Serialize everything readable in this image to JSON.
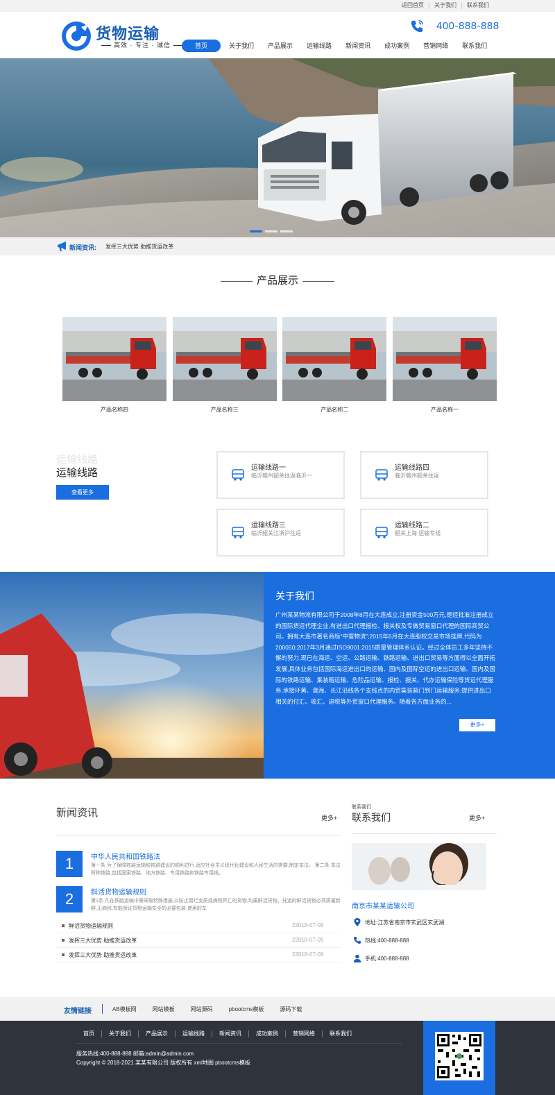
{
  "colors": {
    "accent": "#1a6ee0",
    "brand_dark": "#1a5fb4",
    "footer_bg": "#2f333c"
  },
  "topbar": {
    "links": [
      "返回首页",
      "关于我们",
      "联系我们"
    ]
  },
  "header": {
    "logo_title": "货物运输",
    "logo_sub": "高效 · 专注 · 诚信",
    "phone": "400-888-888",
    "nav": [
      "首页",
      "关于我们",
      "产品展示",
      "运输线路",
      "新闻资讯",
      "成功案例",
      "营销网络",
      "联系我们"
    ]
  },
  "ticker": {
    "label": "新闻资讯:",
    "text": "发挥三大优势 助推货运改革"
  },
  "products": {
    "title": "产品展示",
    "items": [
      {
        "name": "产品名称四"
      },
      {
        "name": "产品名称三"
      },
      {
        "name": "产品名称二"
      },
      {
        "name": "产品名称一"
      }
    ]
  },
  "routes": {
    "ghost_title": "运输线路",
    "title": "运输线路",
    "more": "查看更多",
    "cards": [
      {
        "name": "运输线路一",
        "desc": "临沂赣州韶关往返临沂一"
      },
      {
        "name": "运输线路四",
        "desc": "临沂赣州韶关往返"
      },
      {
        "name": "运输线路三",
        "desc": "临沂韶关江浙沪往返"
      },
      {
        "name": "运输线路二",
        "desc": "韶关上海 运输专线"
      }
    ]
  },
  "about": {
    "title": "关于我们",
    "text": "广州某某物流有限公司于2008年8月在大连成立,注册资金500万元,是经批准注册成立的国际货运代理企业,有进出口代理报检、报关权及专做贸易窗口代理的国际商贸公司。拥有大连市著名商标“中寰物流”;2015年6月在大连股权交易市场挂牌,代码为200050;2017年3月通过ISO9001:2015质量管理体系认证。经过全体员工多年坚持不懈的努力,现已在海运、空运、公路运输、铁路运输、进出口贸易等方面得以全面开拓发展,具体业务包括国际海运进出口的运输、国内及国际空运的进出口运输、国内及国际的铁路运输、集装箱运输、危险品运输、报检、报关、代办运输保险等货运代理服务;承接环黄、渤海、长江沿线各个支线点的内贸集装箱门到门运输服务;提供进出口相关的付汇、收汇、退税等外贸窗口代理服务。随着各方面业务的...",
    "more": "更多+"
  },
  "news": {
    "title": "新闻资讯",
    "more": "更多+",
    "features": [
      {
        "num": "1",
        "title": "中华人民共和国铁路法",
        "desc": "第一条 为了保障铁路运输和铁路建设的顺利进行,适应社会主义现代化建设和人民生活的需要,制定本法。 第二条 本法所称铁路,包括国家铁路、地方铁路、专用铁路和铁路专用线。"
      },
      {
        "num": "2",
        "title": "鲜活货物运输规则",
        "desc": "第1条 凡在铁路运输中需采取特殊措施,以防止腐烂变质或病残死亡的货物,均属鲜活货物。托运的鲜活货物必须质量新鲜,无病残,有能保证货物运输安全的必要包装,使用的车"
      }
    ],
    "list": [
      {
        "title": "鲜活货物运输规则",
        "date": "22018-07-09"
      },
      {
        "title": "发挥三大优势 助推货运改革",
        "date": "22018-07-09"
      },
      {
        "title": "发挥三大优势 助推货运改革",
        "date": "22018-07-09"
      }
    ]
  },
  "contact": {
    "small": "联系我们",
    "title": "联系我们",
    "more": "更多+",
    "company": "南京市某某运输公司",
    "address": "地址:江苏省南京市玄武区玄武湖",
    "hotline": "热线:400-888-888",
    "mobile": "手机:400-888-888"
  },
  "friends": {
    "label": "友情链接",
    "links": [
      "AB模板网",
      "网站模板",
      "网站源码",
      "pbootcms模板",
      "源码下载"
    ]
  },
  "footer": {
    "nav": [
      "首页",
      "关于我们",
      "产品展示",
      "运输线路",
      "新闻资讯",
      "成功案例",
      "营销网络",
      "联系我们"
    ],
    "info1": "服务热线:400-888-888 邮箱:admin@admin.com",
    "info2": "Copyright © 2018-2021 某某有限公司 版权所有 xml地图 pbootcms模板"
  }
}
